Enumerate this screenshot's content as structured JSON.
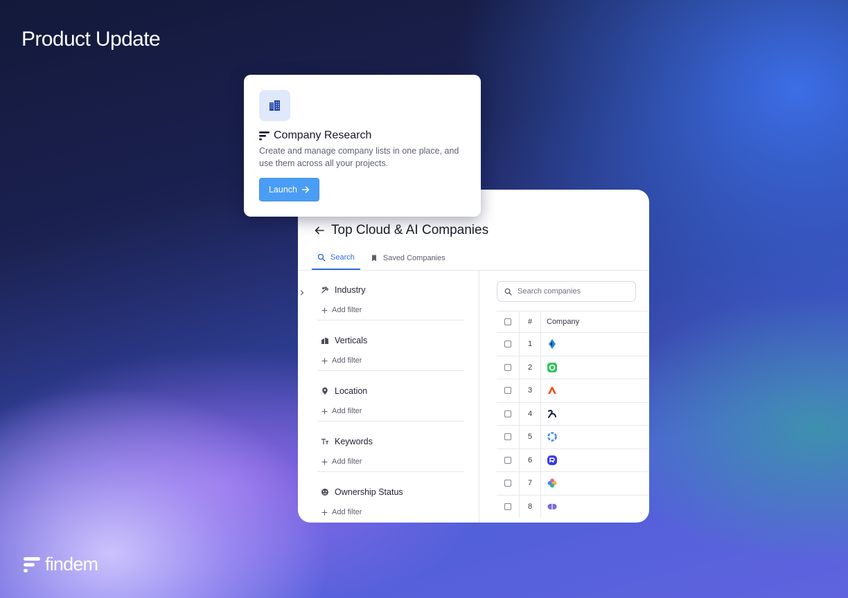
{
  "page": {
    "title": "Product Update",
    "brand_name": "findem"
  },
  "feature_card": {
    "icon": "buildings-icon",
    "title": "Company Research",
    "title_icon": "findem-logo-mark",
    "description": "Create and manage company lists in one place, and use them across all your projects.",
    "launch_label": "Launch"
  },
  "panel": {
    "title": "Top Cloud & AI Companies",
    "tabs": [
      {
        "label": "Search",
        "icon": "search-icon",
        "active": true
      },
      {
        "label": "Saved Companies",
        "icon": "bookmark-icon",
        "active": false
      }
    ],
    "filters": [
      {
        "label": "Industry",
        "icon": "tools-icon",
        "add_label": "Add filter"
      },
      {
        "label": "Verticals",
        "icon": "buildings-icon",
        "add_label": "Add filter"
      },
      {
        "label": "Location",
        "icon": "location-pin-icon",
        "add_label": "Add filter"
      },
      {
        "label": "Keywords",
        "icon": "text-icon",
        "add_label": "Add filter"
      },
      {
        "label": "Ownership Status",
        "icon": "ownership-icon",
        "add_label": "Add filter"
      }
    ],
    "search_placeholder": "Search companies",
    "table": {
      "headers": {
        "number": "#",
        "company": "Company"
      },
      "rows": [
        {
          "num": "1",
          "logo_color": "#1b8fe0"
        },
        {
          "num": "2",
          "logo_color": "#2ec45a"
        },
        {
          "num": "3",
          "logo_color": "#f05023"
        },
        {
          "num": "4",
          "logo_color": "#111c3c"
        },
        {
          "num": "5",
          "logo_color": "#3f8cf0"
        },
        {
          "num": "6",
          "logo_color": "#3a38e6"
        },
        {
          "num": "7",
          "logo_color": "#f0609a"
        },
        {
          "num": "8",
          "logo_color": "#7a6ad8"
        }
      ]
    }
  },
  "colors": {
    "accent": "#2d6fd8",
    "launch_button": "#4a9df5"
  }
}
